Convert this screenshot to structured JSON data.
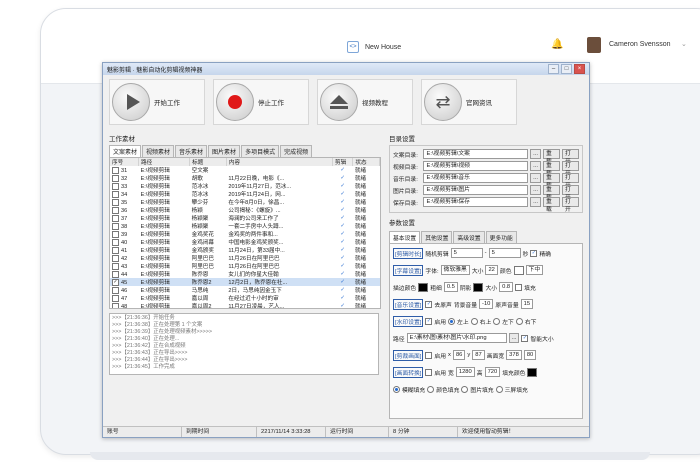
{
  "topbar": {
    "breadcrumb_label": "New House",
    "breadcrumb_icon": "code-brackets-icon",
    "user_name": "Cameron Svensson"
  },
  "window": {
    "title": "魅影剪辑 · 魅影自动化剪辑视频神器",
    "toolbar": [
      {
        "label": "开始工作",
        "icon": "play-icon"
      },
      {
        "label": "停止工作",
        "icon": "stop-icon"
      },
      {
        "label": "视频教程",
        "icon": "eject-icon"
      },
      {
        "label": "官网资讯",
        "icon": "refresh-icon"
      }
    ]
  },
  "left": {
    "group_title": "工作素材",
    "tabs": [
      "文案素材",
      "视频素材",
      "音乐素材",
      "图片素材",
      "多项目模式",
      "完成视频"
    ],
    "columns": [
      "序号",
      "路径",
      "标题",
      "内容",
      "剪辑",
      "状态"
    ],
    "rows": [
      {
        "no": "31",
        "path": "E:\\视频剪辑",
        "title": "空文案",
        "content": "",
        "done": "✓",
        "status": "就绪",
        "checked": false
      },
      {
        "no": "32",
        "path": "E:\\视频剪辑",
        "title": "胡歌",
        "content": "11月22日晚，电影《...",
        "done": "✓",
        "status": "就绪",
        "checked": false
      },
      {
        "no": "33",
        "path": "E:\\视频剪辑",
        "title": "范冰冰",
        "content": "2019年11月27日，范冰...",
        "done": "✓",
        "status": "就绪",
        "checked": false
      },
      {
        "no": "34",
        "path": "E:\\视频剪辑",
        "title": "范冰冰",
        "content": "2019年11月24日，网...",
        "done": "✓",
        "status": "就绪",
        "checked": false
      },
      {
        "no": "35",
        "path": "E:\\视频剪辑",
        "title": "攀少芬",
        "content": "在今年8月0日，徐昌...",
        "done": "✓",
        "status": "就绪",
        "checked": false
      },
      {
        "no": "36",
        "path": "E:\\视频剪辑",
        "title": "杨颖",
        "content": "公司揭秘：《螺旋》...",
        "done": "✓",
        "status": "就绪",
        "checked": false
      },
      {
        "no": "37",
        "path": "E:\\视频剪辑",
        "title": "杨颖聚",
        "content": "海澜的公司来工作了",
        "done": "✓",
        "status": "就绪",
        "checked": false
      },
      {
        "no": "38",
        "path": "E:\\视频剪辑",
        "title": "杨颖聚",
        "content": "一套二手房中人头蹲...",
        "done": "✓",
        "status": "就绪",
        "checked": false
      },
      {
        "no": "39",
        "path": "E:\\视频剪辑",
        "title": "金鸡奖花",
        "content": "金鸡奖的两件事和...",
        "done": "✓",
        "status": "就绪",
        "checked": false
      },
      {
        "no": "40",
        "path": "E:\\视频剪辑",
        "title": "金鸡闭幕",
        "content": "中国电影金鸡奖颁奖...",
        "done": "✓",
        "status": "就绪",
        "checked": false
      },
      {
        "no": "41",
        "path": "E:\\视频剪辑",
        "title": "金鸡颁奖",
        "content": "11月24日，第33届中...",
        "done": "✓",
        "status": "就绪",
        "checked": false
      },
      {
        "no": "42",
        "path": "E:\\视频剪辑",
        "title": "阿里巴巴",
        "content": "11月26日在阿里巴巴",
        "done": "✓",
        "status": "就绪",
        "checked": false
      },
      {
        "no": "43",
        "path": "E:\\视频剪辑",
        "title": "阿里巴巴",
        "content": "11月26日在阿里巴巴",
        "done": "✓",
        "status": "就绪",
        "checked": false
      },
      {
        "no": "44",
        "path": "E:\\视频剪辑",
        "title": "陈乔恩",
        "content": "女儿们的你星大佳翰",
        "done": "✓",
        "status": "就绪",
        "checked": false
      },
      {
        "no": "45",
        "path": "E:\\视频剪辑",
        "title": "陈乔恩2",
        "content": "12月2日，陈乔恩在社...",
        "done": "✓",
        "status": "就绪",
        "checked": true
      },
      {
        "no": "46",
        "path": "E:\\视频剪辑",
        "title": "马思纯",
        "content": "2日，马思纯因金玉下",
        "done": "✓",
        "status": "就绪",
        "checked": false
      },
      {
        "no": "47",
        "path": "E:\\视频剪辑",
        "title": "嘉以周",
        "content": "在经过近十小时的审",
        "done": "✓",
        "status": "就绪",
        "checked": false
      },
      {
        "no": "48",
        "path": "E:\\视频剪辑",
        "title": "嘉以周2",
        "content": "11月27日凌晨，艺人...",
        "done": "✓",
        "status": "就绪",
        "checked": false
      }
    ],
    "log": [
      ">>>【21:36:36】开始任务",
      ">>>【21:36:38】正在处理第 1 个文案",
      ">>>【21:36:39】正在处理视频素材>>>>>",
      ">>>【21:36:40】正在处理...",
      ">>>【21:36:42】正在合成视频",
      ">>>【21:36:43】正在导出>>>>",
      ">>>【21:36:44】正在导出>>>>",
      ">>>【21:36:45】工作完成"
    ]
  },
  "right": {
    "dir_title": "目录设置",
    "dirs": [
      {
        "label": "文案目录:",
        "value": "E:\\视频剪辑\\文案"
      },
      {
        "label": "视频目录:",
        "value": "E:\\视频剪辑\\视频"
      },
      {
        "label": "音乐目录:",
        "value": "E:\\视频剪辑\\音乐"
      },
      {
        "label": "图片目录:",
        "value": "E:\\视频剪辑\\图片"
      },
      {
        "label": "保存目录:",
        "value": "E:\\视频剪辑\\保存"
      }
    ],
    "dir_btn_browse": "...",
    "dir_btn_reload": "重载",
    "dir_btn_open": "打开",
    "param_title": "参数设置",
    "param_tabs": [
      "基本设置",
      "其他设置",
      "高级设置",
      "更多功能"
    ],
    "clip": {
      "tag": "[剪辑时长]",
      "label": "随机剪辑",
      "from": "5",
      "to": "5",
      "unit": "秒",
      "extra": "精确"
    },
    "subtitle": {
      "tag": "[字幕设置]",
      "font_label": "字体:",
      "font": "微软雅黑",
      "size_label": "大小",
      "size": "22",
      "color_label": "颜色",
      "pos": "下中",
      "stroke_label": "描边颜色",
      "border_label": "粗细",
      "border": "0.5",
      "shadow_label": "阴影",
      "shadow_size_label": "大小",
      "shadow_size": "0.8",
      "fill_label": "填充",
      "color": "#ffffff",
      "stroke": "#000000"
    },
    "music": {
      "tag": "[音乐设置]",
      "remove": "去原声",
      "bg_label": "背景音量",
      "bg": "-10",
      "orig_label": "原声音量",
      "orig": "15"
    },
    "watermark": {
      "tag": "[水印设置]",
      "enable": "启用",
      "positions": [
        "左上",
        "右上",
        "左下",
        "右下"
      ],
      "path_label": "路径",
      "path": "E:\\素材\\图\\素材\\图片\\水印.png",
      "adaptive": "智能大小"
    },
    "crop": {
      "tag": "[剪裁画面]",
      "enable": "启用",
      "x_label": "x",
      "x": "86",
      "y_label": "y",
      "y": "87",
      "size_label": "画面宽",
      "w": "378",
      "h": "80"
    },
    "resize": {
      "tag": "[画面转换]",
      "enable": "启用",
      "w_label": "宽",
      "w": "1280",
      "h_label": "高",
      "h": "720",
      "fill_label": "填充颜色",
      "fill": "#000000"
    },
    "fill_modes": [
      "模糊填充",
      "颜色填充",
      "图片填充",
      "三屏填充"
    ]
  },
  "status_bar": [
    "账号",
    "到期时间",
    "2217/11/14 3:33:28",
    "运行时间",
    "8 分钟",
    "欢迎使用智动剪辑！"
  ]
}
